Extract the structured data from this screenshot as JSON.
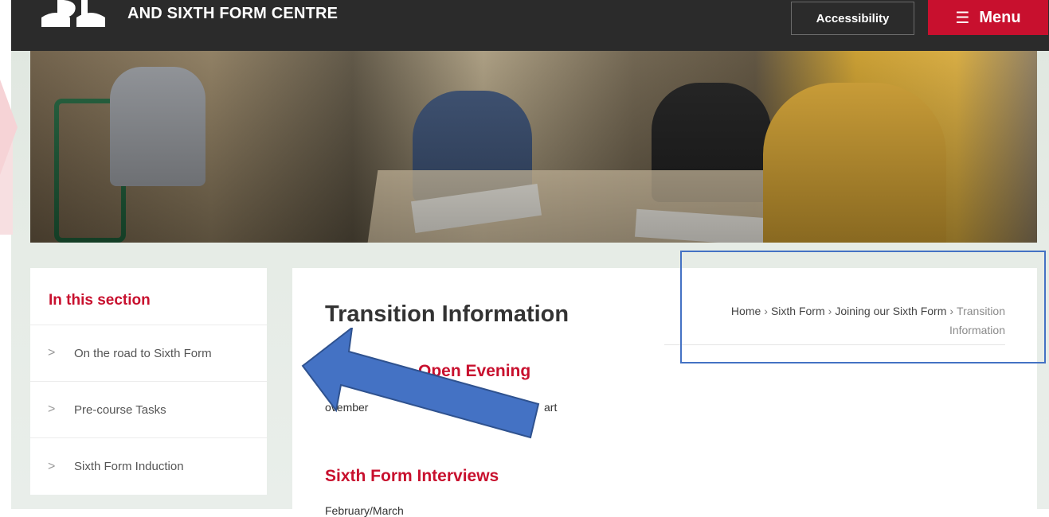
{
  "header": {
    "school_name": "AND SIXTH FORM CENTRE",
    "accessibility_label": "Accessibility",
    "menu_label": "Menu",
    "menu_icon": "hamburger-icon"
  },
  "sidebar": {
    "title": "In this section",
    "items": [
      {
        "label": "On the road to Sixth Form"
      },
      {
        "label": "Pre-course Tasks"
      },
      {
        "label": "Sixth Form Induction"
      }
    ]
  },
  "main": {
    "title": "Transition Information",
    "breadcrumb": {
      "home": "Home",
      "sixth_form": "Sixth Form",
      "joining": "Joining our Sixth Form",
      "current_line1": "Transition",
      "current_line2": "Information"
    },
    "sections": [
      {
        "heading": "Open Evening",
        "text": "ovember",
        "text_tail": "art"
      },
      {
        "heading": "Sixth Form Interviews",
        "text": "February/March"
      }
    ]
  },
  "colors": {
    "brand_red": "#c8102e",
    "header_dark": "#2b2b2b",
    "annotation_blue": "#4472c4"
  }
}
